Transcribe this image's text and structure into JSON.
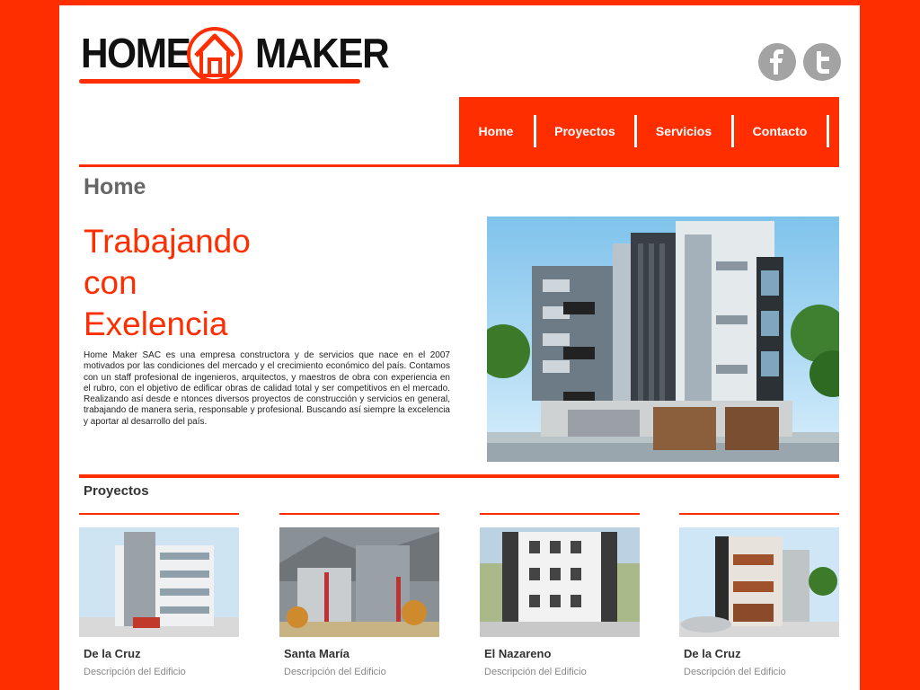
{
  "brand": {
    "word1": "HOME",
    "word2": "MAKER",
    "accent": "#ff2e00",
    "icon": "house-icon"
  },
  "social": [
    {
      "name": "facebook-icon",
      "glyph": "f"
    },
    {
      "name": "twitter-icon",
      "glyph": "t"
    }
  ],
  "nav": {
    "items": [
      "Home",
      "Proyectos",
      "Servicios",
      "Contacto"
    ]
  },
  "page": {
    "title": "Home"
  },
  "hero": {
    "line1": "Trabajando",
    "line2": "con",
    "line3": "Exelencia",
    "body": "Home Maker SAC es una empresa constructora y de servicios que nace en el 2007 motivados por las condiciones del mercado y el crecimiento económico del país. Contamos con un staff profesional de ingenieros, arquitectos, y maestros de obra con experiencia en el rubro, con el objetivo de edificar obras de calidad total y ser competitivos en el mercado. Realizando así desde e ntonces diversos proyectos de construcción y servicios en general, trabajando de manera seria, responsable y profesional. Buscando así siempre la excelencia y aportar al desarrollo del país."
  },
  "projects": {
    "title": "Proyectos",
    "items": [
      {
        "name": "De la Cruz",
        "description": "Descripción del Edificio"
      },
      {
        "name": "Santa María",
        "description": "Descripción del Edificio"
      },
      {
        "name": "El Nazareno",
        "description": "Descripción del Edificio"
      },
      {
        "name": "De la Cruz",
        "description": "Descripción del Edificio"
      }
    ]
  }
}
